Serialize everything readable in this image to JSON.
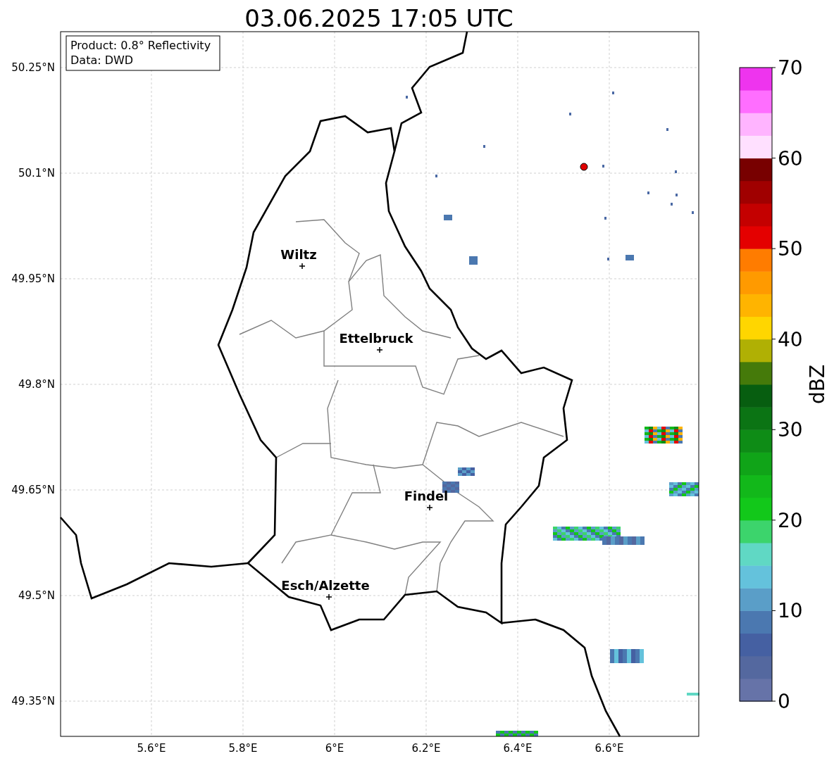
{
  "title": "03.06.2025 17:05 UTC",
  "info_box": [
    "Product: 0.8° Reflectivity",
    "Data: DWD"
  ],
  "y_ticks": [
    "50.25°N",
    "50.1°N",
    "49.95°N",
    "49.8°N",
    "49.65°N",
    "49.5°N",
    "49.35°N"
  ],
  "x_ticks": [
    "5.6°E",
    "5.8°E",
    "6°E",
    "6.2°E",
    "6.4°E",
    "6.6°E"
  ],
  "cities": [
    {
      "name": "Wiltz"
    },
    {
      "name": "Ettelbruck"
    },
    {
      "name": "Findel"
    },
    {
      "name": "Esch/Alzette"
    }
  ],
  "colorbar": {
    "label": "dBZ",
    "ticks": [
      "70",
      "60",
      "50",
      "40",
      "30",
      "20",
      "10",
      "0"
    ],
    "bins": [
      {
        "color": "#6673a8"
      },
      {
        "color": "#54689f"
      },
      {
        "color": "#4560a2"
      },
      {
        "color": "#4b78b0"
      },
      {
        "color": "#5a9ec8"
      },
      {
        "color": "#64c2dc"
      },
      {
        "color": "#60d8c4"
      },
      {
        "color": "#3cd46c"
      },
      {
        "color": "#12c81a"
      },
      {
        "color": "#12b81a"
      },
      {
        "color": "#10a418"
      },
      {
        "color": "#0e8c16"
      },
      {
        "color": "#0b7414"
      },
      {
        "color": "#075e10"
      },
      {
        "color": "#457a0a"
      },
      {
        "color": "#b0b004"
      },
      {
        "color": "#ffd600"
      },
      {
        "color": "#ffb400"
      },
      {
        "color": "#ff9a00"
      },
      {
        "color": "#ff7c00"
      },
      {
        "color": "#e40000"
      },
      {
        "color": "#c40000"
      },
      {
        "color": "#a00000"
      },
      {
        "color": "#780000"
      },
      {
        "color": "#ffe0ff"
      },
      {
        "color": "#ffb4ff"
      },
      {
        "color": "#ff6eff"
      },
      {
        "color": "#ee34ee"
      }
    ]
  }
}
